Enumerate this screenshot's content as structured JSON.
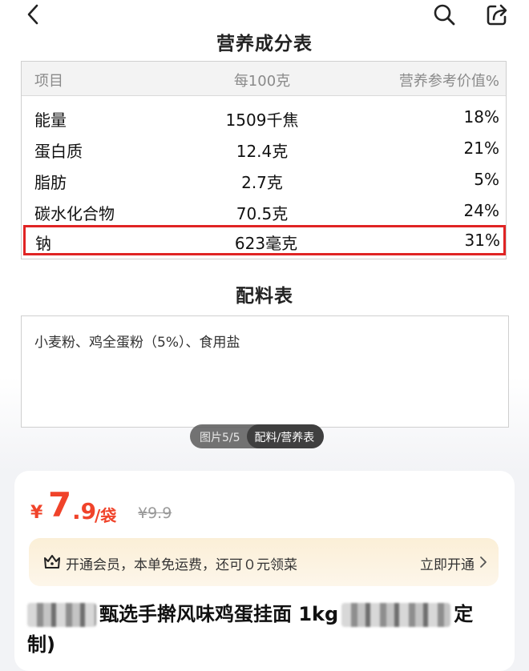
{
  "nutrition": {
    "title": "营养成分表",
    "headers": [
      "项目",
      "每100克",
      "营养参考价值%"
    ],
    "rows": [
      {
        "item": "能量",
        "amount": "1509千焦",
        "nrv": "18%"
      },
      {
        "item": "蛋白质",
        "amount": "12.4克",
        "nrv": "21%"
      },
      {
        "item": "脂肪",
        "amount": "2.7克",
        "nrv": "5%"
      },
      {
        "item": "碳水化合物",
        "amount": "70.5克",
        "nrv": "24%"
      },
      {
        "item": "钠",
        "amount": "623毫克",
        "nrv": "31%",
        "highlighted": true
      }
    ],
    "highlight_color": "#e02424"
  },
  "ingredients": {
    "title": "配料表",
    "text": "小麦粉、鸡全蛋粉（5%）、食用盐"
  },
  "image_counter": {
    "index": "图片5/5",
    "label": "配料/营养表"
  },
  "price": {
    "currency": "¥",
    "integer": "7",
    "decimal": ".9",
    "unit": "/袋",
    "original": "¥9.9",
    "color": "#f0432a"
  },
  "member": {
    "text": "开通会员，本单免运费，还可０元领菜",
    "link": "立即开通"
  },
  "product": {
    "title_part1": "甄选手擀风味鸡蛋挂面 1kg",
    "title_part2": "定",
    "title_part3": "制)"
  },
  "icons": {
    "back": "chevron-left-icon",
    "search": "search-icon",
    "share": "share-icon",
    "member": "crown-icon",
    "more": "chevron-right-icon"
  }
}
